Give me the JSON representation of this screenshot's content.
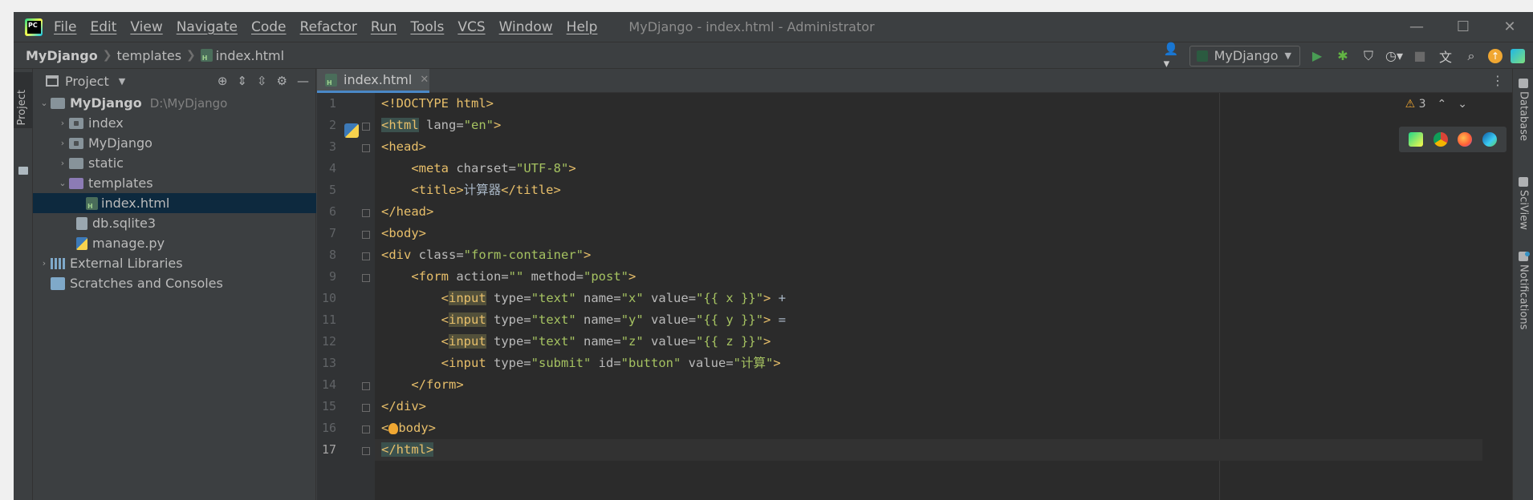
{
  "window": {
    "title": "MyDjango - index.html - Administrator",
    "menu": [
      "File",
      "Edit",
      "View",
      "Navigate",
      "Code",
      "Refactor",
      "Run",
      "Tools",
      "VCS",
      "Window",
      "Help"
    ],
    "controls": {
      "minimize": "—",
      "maximize": "☐",
      "close": "✕"
    }
  },
  "breadcrumb": [
    "MyDjango",
    "templates",
    "index.html"
  ],
  "toolbar": {
    "run_config": "MyDjango",
    "icons": [
      "user-icon",
      "run-icon",
      "debug-icon",
      "coverage-icon",
      "profile-icon",
      "stop-icon",
      "translate-icon",
      "search-icon",
      "update-icon",
      "ai-assistant-icon"
    ]
  },
  "left_strip": {
    "project_tab": "Project"
  },
  "project": {
    "title": "Project",
    "tree": [
      {
        "label": "MyDjango",
        "extra": "D:\\MyDjango",
        "kind": "root",
        "depth": 0,
        "expanded": true
      },
      {
        "label": "index",
        "kind": "package",
        "depth": 1,
        "expanded": false
      },
      {
        "label": "MyDjango",
        "kind": "package",
        "depth": 1,
        "expanded": false
      },
      {
        "label": "static",
        "kind": "folder",
        "depth": 1,
        "expanded": false
      },
      {
        "label": "templates",
        "kind": "templates",
        "depth": 1,
        "expanded": true
      },
      {
        "label": "index.html",
        "kind": "html",
        "depth": 2,
        "selected": true
      },
      {
        "label": "db.sqlite3",
        "kind": "db",
        "depth": 1
      },
      {
        "label": "manage.py",
        "kind": "python",
        "depth": 1
      },
      {
        "label": "External Libraries",
        "kind": "libs",
        "depth": 0,
        "expanded": false
      },
      {
        "label": "Scratches and Consoles",
        "kind": "scratches",
        "depth": 0
      }
    ]
  },
  "editor": {
    "tab": {
      "label": "index.html",
      "close": "✕"
    },
    "inspections": {
      "warnings": "3"
    },
    "current_line": 17,
    "lines": [
      "<!DOCTYPE html>",
      "<html lang=\"en\">",
      "<head>",
      "    <meta charset=\"UTF-8\">",
      "    <title>计算器</title>",
      "</head>",
      "<body>",
      "<div class=\"form-container\">",
      "    <form action=\"\" method=\"post\">",
      "        <input type=\"text\" name=\"x\" value=\"{{ x }}\"> +",
      "        <input type=\"text\" name=\"y\" value=\"{{ y }}\"> =",
      "        <input type=\"text\" name=\"z\" value=\"{{ z }}\">",
      "        <input type=\"submit\" id=\"button\" value=\"计算\">",
      "    </form>",
      "</div>",
      "</body>",
      "</html>"
    ],
    "browsers": [
      "pycharm-icon",
      "chrome-icon",
      "firefox-icon",
      "edge-icon"
    ]
  },
  "right_strip": [
    "Database",
    "SciView",
    "Notifications"
  ],
  "colors": {
    "background": "#2b2b2b",
    "panel": "#3c3f41",
    "tag": "#e8bf6a",
    "attr_value": "#a5c261",
    "selection": "#0d293e",
    "warning": "#f0a732"
  }
}
